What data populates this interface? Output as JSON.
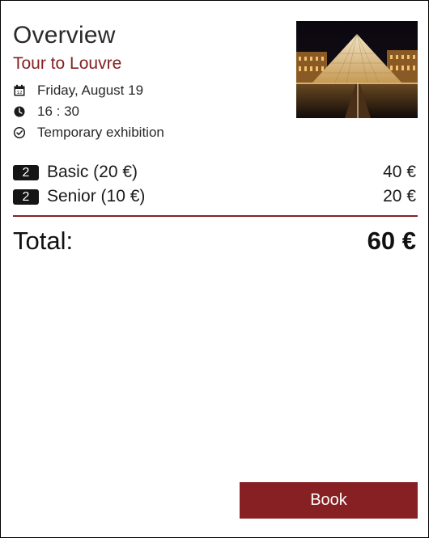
{
  "header": {
    "title": "Overview",
    "subtitle": "Tour to Louvre"
  },
  "details": {
    "date": "Friday, August 19",
    "date_icon": "calendar-icon",
    "time": "16 : 30",
    "time_icon": "clock-icon",
    "exhibition": "Temporary exhibition",
    "exhibition_icon": "check-circle-icon"
  },
  "image": {
    "subject": "louvre-pyramid-photo"
  },
  "tickets": [
    {
      "quantity": "2",
      "label": "Basic (20 €)",
      "price": "40 €"
    },
    {
      "quantity": "2",
      "label": "Senior (10 €)",
      "price": "20 €"
    }
  ],
  "summary": {
    "total_label": "Total:",
    "total_value": "60 €"
  },
  "actions": {
    "book_label": "Book"
  },
  "colors": {
    "accent": "#862023",
    "badge": "#151515",
    "text": "#1a1a1a"
  }
}
